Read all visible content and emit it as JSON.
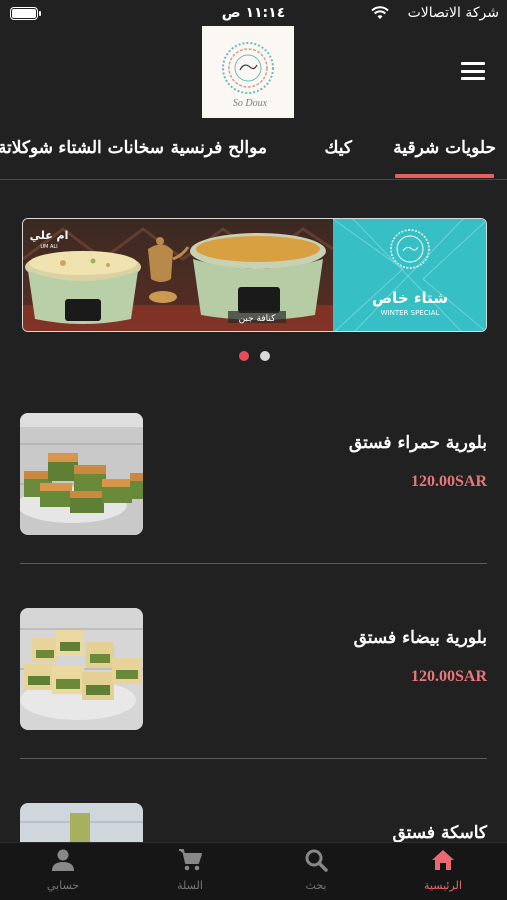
{
  "status_bar": {
    "time": "١١:١٤ ص",
    "carrier": "شركة الاتصالات"
  },
  "header": {
    "logo_text": "So Doux",
    "menu_icon": "hamburger-menu-icon"
  },
  "tabs": [
    {
      "label": "حلويات شرقية",
      "active": true
    },
    {
      "label": "كيك",
      "active": false
    },
    {
      "label": "موالح فرنسية",
      "active": false
    },
    {
      "label": "سخانات الشتاء",
      "active": false
    },
    {
      "label": "شوكلاتة",
      "active": false
    }
  ],
  "banner": {
    "title_ar": "شتاء خاص",
    "title_en": "WINTER SPECIAL",
    "dish_left": "ام علي",
    "dish_left_en": "UM ALI",
    "dish_right": "كنافة جبن"
  },
  "carousel": {
    "slides": 2,
    "active_index": 0
  },
  "products": [
    {
      "name": "بلورية حمراء فستق",
      "price": "120.00SAR"
    },
    {
      "name": "بلورية بيضاء فستق",
      "price": "120.00SAR"
    },
    {
      "name": "كاسكة فستق",
      "price": ""
    }
  ],
  "bottom_nav": [
    {
      "label": "الرئيسية",
      "icon": "home-icon",
      "active": true
    },
    {
      "label": "بحث",
      "icon": "search-icon",
      "active": false
    },
    {
      "label": "السلة",
      "icon": "cart-icon",
      "active": false
    },
    {
      "label": "حسابي",
      "icon": "account-icon",
      "active": false
    }
  ],
  "colors": {
    "background": "#212121",
    "accent": "#e85f60",
    "price": "#e8777a",
    "banner_teal": "#36bfc5"
  }
}
